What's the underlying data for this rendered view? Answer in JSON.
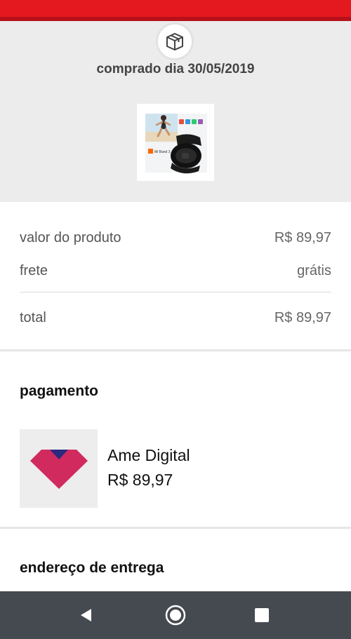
{
  "header": {
    "accent_color": "#e4191f",
    "icon": "package-box-icon"
  },
  "order": {
    "purchase_date": "comprado dia 30/05/2019",
    "product_image": {
      "icon": "product-photo",
      "band_label": "Mi Band 3"
    }
  },
  "summary": {
    "product_value_label": "valor do produto",
    "product_value": "R$ 89,97",
    "shipping_label": "frete",
    "shipping_value": "grátis",
    "total_label": "total",
    "total_value": "R$ 89,97"
  },
  "payment": {
    "title": "pagamento",
    "method_name": "Ame Digital",
    "amount": "R$ 89,97",
    "logo_icon": "ame-digital-logo",
    "logo_colors": [
      "#d12a5f",
      "#2b2a7e"
    ]
  },
  "delivery": {
    "title": "endereço de entrega"
  },
  "navbar": {
    "background": "#444a4f",
    "back_icon": "back-triangle-icon",
    "home_icon": "home-circle-icon",
    "recents_icon": "recents-square-icon"
  }
}
